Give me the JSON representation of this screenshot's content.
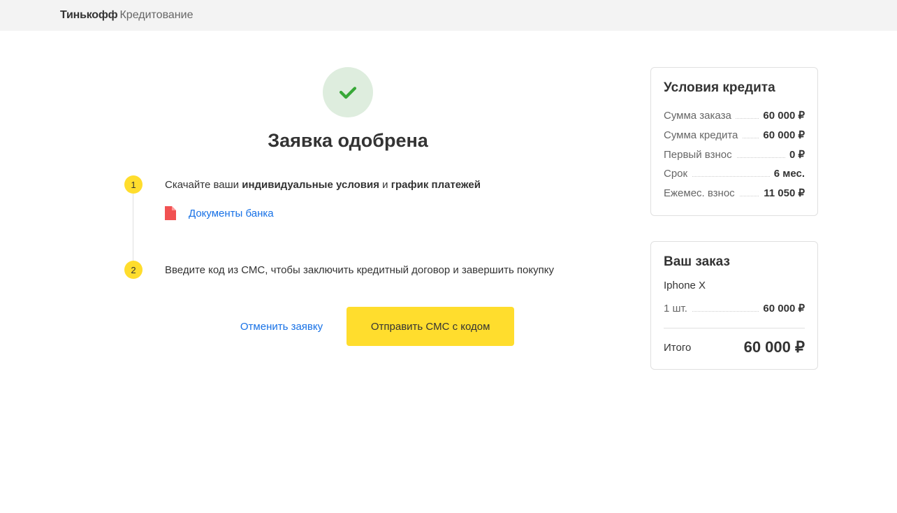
{
  "header": {
    "brand_bold": "Тинькофф",
    "brand_light": "Кредитование"
  },
  "main": {
    "title": "Заявка одобрена",
    "step1_number": "1",
    "step1_prefix": "Скачайте ваши ",
    "step1_bold1": "индивидуальные условия",
    "step1_mid": " и ",
    "step1_bold2": "график платежей",
    "doc_link": "Документы банка",
    "step2_number": "2",
    "step2_text": "Введите код из СМС, чтобы заключить кредитный договор и завершить покупку",
    "cancel": "Отменить заявку",
    "submit": "Отправить СМС с кодом"
  },
  "credit": {
    "title": "Условия кредита",
    "rows": [
      {
        "label": "Сумма заказа",
        "value": "60 000 ₽"
      },
      {
        "label": "Сумма кредита",
        "value": "60 000 ₽"
      },
      {
        "label": "Первый взнос",
        "value": "0 ₽"
      },
      {
        "label": "Срок",
        "value": "6 мес."
      },
      {
        "label": "Ежемес. взнос",
        "value": "11 050 ₽"
      }
    ]
  },
  "order": {
    "title": "Ваш заказ",
    "item": "Iphone X",
    "qty_label": "1 шт.",
    "qty_value": "60 000 ₽",
    "total_label": "Итого",
    "total_value": "60 000 ₽"
  }
}
